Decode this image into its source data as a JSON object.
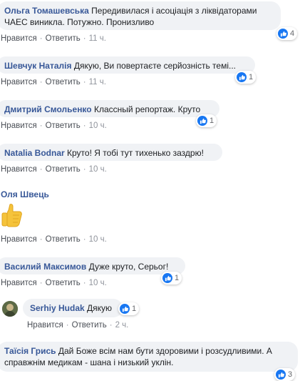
{
  "labels": {
    "like": "Нравится",
    "reply": "Ответить",
    "dot": "·"
  },
  "comments": [
    {
      "author": "Ольга Томашевська",
      "text": "Передивилася і асоціація з ліквідаторами ЧАЕС виникла. Потужно. Пронизливо",
      "time": "11 ч.",
      "reactions": "4"
    },
    {
      "author": "Шевчук Наталія",
      "text": "Дякую, Ви повертаєте серйозність темі...",
      "time": "11 ч.",
      "reactions": "1"
    },
    {
      "author": "Дмитрий Смольенко",
      "text": "Классный репортаж. Круто",
      "time": "10 ч.",
      "reactions": "1"
    },
    {
      "author": "Natalia Bodnar",
      "text": "Круто! Я тобі тут тихенько заздрю!",
      "time": "10 ч."
    },
    {
      "author": "Оля Швець",
      "text": "",
      "time": "10 ч."
    },
    {
      "author": "Василий Максимов",
      "text": "Дуже круто, Серьог!",
      "time": "10 ч.",
      "reactions": "1"
    },
    {
      "author": "Serhiy Hudak",
      "text": "Дякую",
      "time": "2 ч.",
      "reactions": "1"
    },
    {
      "author": "Таїсія Грись",
      "text": "Дай Боже всім нам бути здоровими і розсудливими. А справжнім медикам - шана і низький уклін.",
      "time": "",
      "reactions": "3"
    }
  ],
  "colors": {
    "like_blue": "#1877f2",
    "author": "#385898",
    "bubble": "#f0f2f5"
  },
  "icons": {
    "reaction": "thumbs-up-icon",
    "sticker": "thumbs-up-emoji-icon"
  }
}
